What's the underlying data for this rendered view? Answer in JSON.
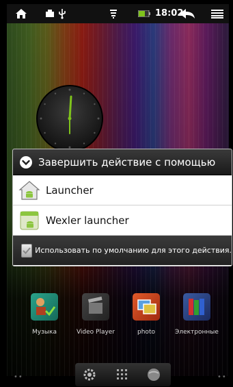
{
  "status_bar": {
    "time": "18:02",
    "icons": [
      "home-icon",
      "usb-storage-icon",
      "usb-debug-icon",
      "signal-icon",
      "battery-icon",
      "back-icon",
      "menu-icon"
    ]
  },
  "dialog": {
    "title": "Завершить действие с помощью",
    "options": [
      {
        "label": "Launcher"
      },
      {
        "label": "Wexler launcher"
      }
    ],
    "default_checkbox_label": "Использовать по умолчанию для этого действия.",
    "default_checked": true
  },
  "home_apps": [
    {
      "label": "Музыка"
    },
    {
      "label": "Video Player"
    },
    {
      "label": "photo"
    },
    {
      "label": "Электронные"
    }
  ],
  "dock": {
    "icons": [
      "settings-icon",
      "app-grid-icon",
      "browser-icon"
    ]
  },
  "colors": {
    "dialog_header": "#262626",
    "dialog_item_bg": "#ffffff",
    "clock_hand": "#7fc31c"
  }
}
